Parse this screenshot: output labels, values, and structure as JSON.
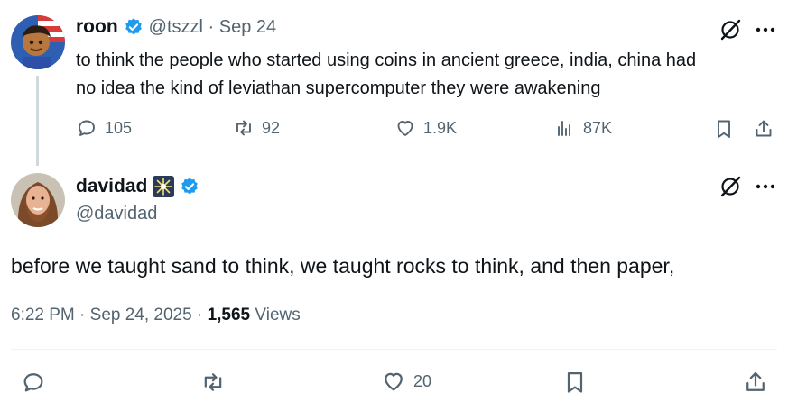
{
  "colors": {
    "accent": "#1d9bf0",
    "muted": "#536471",
    "text": "#0f1419",
    "line": "#cfd9de"
  },
  "parent_tweet": {
    "author_name": "roon",
    "handle_and_date": "@tszzl · Sep 24",
    "text_line1": "to think the people who started using coins in ancient greece, india, china had",
    "text_line2": "no idea the kind of leviathan supercomputer they were awakening",
    "stats": {
      "replies": "105",
      "reposts": "92",
      "likes": "1.9K",
      "views": "87K"
    },
    "icons": [
      "grok-icon",
      "more-icon",
      "reply-icon",
      "repost-icon",
      "like-icon",
      "views-icon",
      "bookmark-icon",
      "share-icon"
    ]
  },
  "main_tweet": {
    "author_name": "davidad",
    "emoji_badge": "sparkle-badge",
    "handle": "@davidad",
    "text": "before we taught sand to think, we taught rocks to think, and then paper,",
    "time": "6:22 PM · Sep 24, 2025 · ",
    "views_count": "1,565",
    "views_label": " Views",
    "stats": {
      "likes": "20"
    }
  }
}
